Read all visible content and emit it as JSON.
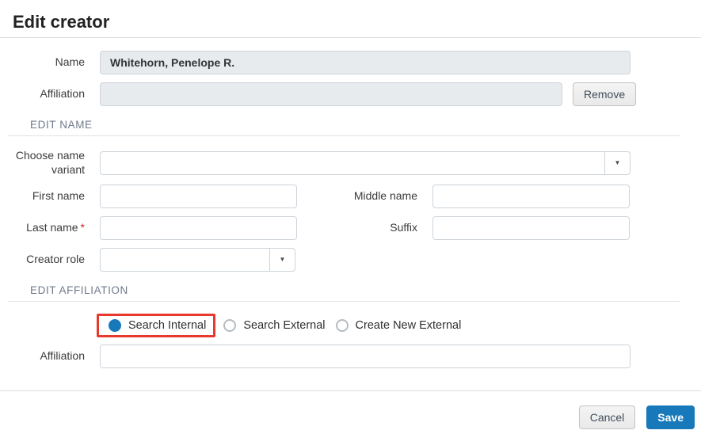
{
  "dialog": {
    "title": "Edit creator"
  },
  "colors": {
    "accent_blue": "#1779ba",
    "annotation_red": "#e8392d",
    "disabled_field_bg": "#e7ebee",
    "field_border": "#ced4da",
    "section_header_text": "#6f7a8a",
    "required_marker_red": "#e02020"
  },
  "sections": {
    "edit_name": "EDIT NAME",
    "edit_affiliation": "EDIT AFFILIATION"
  },
  "fields": {
    "name": {
      "label": "Name",
      "value": "Whitehorn, Penelope R."
    },
    "affiliation_top": {
      "label": "Affiliation",
      "value": ""
    },
    "choose_name_variant": {
      "label": "Choose name variant",
      "value": ""
    },
    "first_name": {
      "label": "First name",
      "value": ""
    },
    "middle_name": {
      "label": "Middle name",
      "value": ""
    },
    "last_name": {
      "label": "Last name",
      "required_marker": "*",
      "value": ""
    },
    "suffix": {
      "label": "Suffix",
      "value": ""
    },
    "creator_role": {
      "label": "Creator role",
      "value": ""
    },
    "affiliation_bottom": {
      "label": "Affiliation",
      "value": ""
    }
  },
  "buttons": {
    "remove": "Remove",
    "cancel": "Cancel",
    "save": "Save"
  },
  "icons": {
    "dropdown_caret": "▼"
  },
  "radios": [
    {
      "label": "Search Internal",
      "selected": true,
      "highlighted": true
    },
    {
      "label": "Search External",
      "selected": false,
      "highlighted": false
    },
    {
      "label": "Create New External",
      "selected": false,
      "highlighted": false
    }
  ]
}
